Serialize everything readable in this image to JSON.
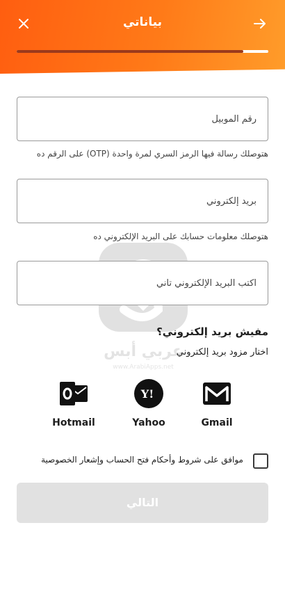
{
  "header": {
    "title": "بياناتي",
    "progress": 0.9,
    "close_icon": "close-icon",
    "back_icon": "arrow-right-icon"
  },
  "fields": {
    "mobile": {
      "placeholder": "رقم الموبيل",
      "value": "",
      "hint": "هتوصلك رسالة فيها الرمز السري لمرة واحدة (OTP) على الرقم ده"
    },
    "email": {
      "placeholder": "بريد إلكتروني",
      "value": "",
      "hint": "هتوصلك معلومات حسابك على البريد الإلكتروني ده"
    },
    "email_confirm": {
      "placeholder": "اكتب البريد الإلكتروني تاني",
      "value": ""
    }
  },
  "watermark": {
    "text": "عربي أبس",
    "url": "www.ArabiApps.net"
  },
  "no_email": {
    "title": "مفيش بريد إلكتروني؟",
    "subtitle": "اختار مزود بريد إلكتروني",
    "providers": [
      {
        "label": "Hotmail",
        "icon": "hotmail-icon"
      },
      {
        "label": "Yahoo",
        "icon": "yahoo-icon"
      },
      {
        "label": "Gmail",
        "icon": "gmail-icon"
      }
    ]
  },
  "terms": {
    "label": "موافق على شروط وأحكام فتح الحساب وإشعار الخصوصية",
    "checked": false
  },
  "next_button": {
    "label": "التالي",
    "enabled": false
  },
  "colors": {
    "accent": "#ff6a14",
    "progress_fill": "#9b3a1c",
    "button_disabled": "#e1e1e1"
  }
}
